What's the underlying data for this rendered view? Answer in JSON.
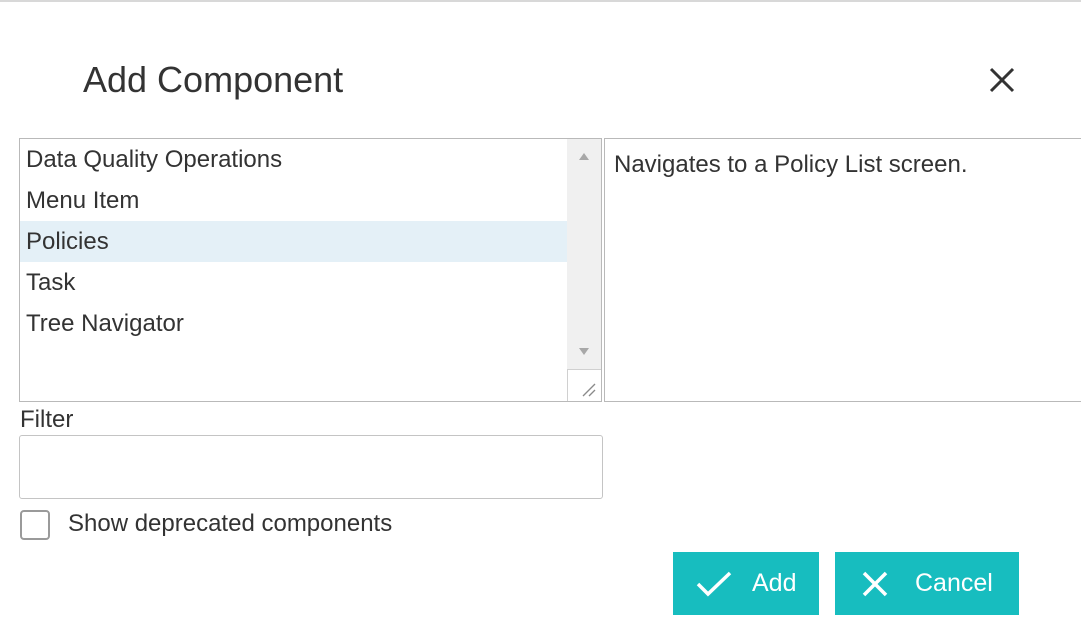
{
  "dialog": {
    "title": "Add Component",
    "close_icon": "close-icon"
  },
  "component_list": {
    "items": [
      {
        "label": "Data Quality Operations",
        "selected": false
      },
      {
        "label": "Menu Item",
        "selected": false
      },
      {
        "label": "Policies",
        "selected": true
      },
      {
        "label": "Task",
        "selected": false
      },
      {
        "label": "Tree Navigator",
        "selected": false
      }
    ]
  },
  "description": {
    "text": "Navigates to a Policy List screen."
  },
  "filter": {
    "label": "Filter",
    "value": "",
    "placeholder": ""
  },
  "deprecated": {
    "label": "Show deprecated components",
    "checked": false
  },
  "buttons": {
    "add_label": "Add",
    "add_icon": "checkmark-icon",
    "cancel_label": "Cancel",
    "cancel_icon": "close-icon"
  },
  "colors": {
    "accent": "#17bdbf",
    "selected_row": "#e4f0f7",
    "text": "#333333"
  }
}
